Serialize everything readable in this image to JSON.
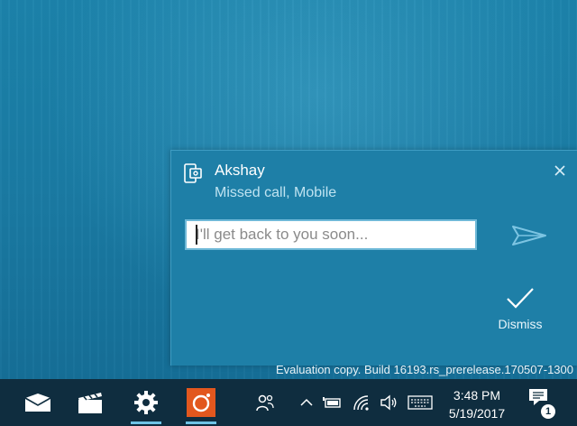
{
  "notification": {
    "title": "Akshay",
    "subtitle": "Missed call, Mobile",
    "reply_placeholder": "I'll get back to you soon...",
    "dismiss_label": "Dismiss",
    "app_icon": "phone-app-icon",
    "close_icon": "close-icon",
    "send_icon": "send-icon",
    "dismiss_icon": "checkmark-icon"
  },
  "watermark": "Evaluation copy. Build 16193.rs_prerelease.170507-1300",
  "taskbar": {
    "apps": [
      {
        "icon": "mail-icon"
      },
      {
        "icon": "movies-tv-icon"
      },
      {
        "icon": "settings-gear-icon"
      },
      {
        "icon": "camera-app-icon"
      }
    ],
    "tray": [
      "people-icon",
      "chevron-up-icon",
      "battery-icon",
      "wifi-icon",
      "volume-icon",
      "keyboard-icon"
    ],
    "time": "3:48 PM",
    "date": "5/19/2017",
    "notification_count": "1",
    "accent": "#6ec3e6"
  }
}
